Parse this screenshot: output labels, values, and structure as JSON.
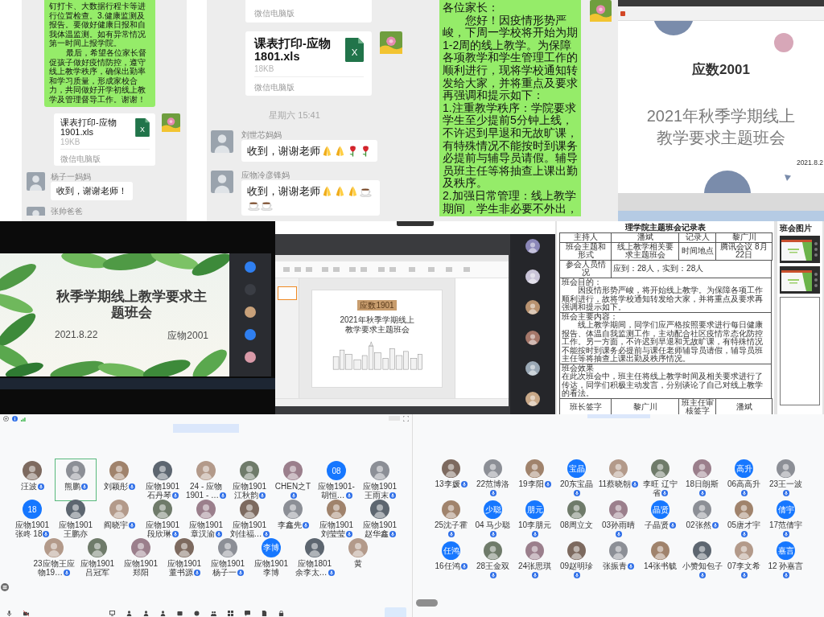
{
  "chats": [
    {
      "messages": [
        {
          "kind": "text",
          "from_me": true,
          "avatar": false,
          "paragraphs": [
            {
              "text": "钉打卡、大数据行程卡等进行位置检查。3.健康监测及报告。要做好健康日报和自我体温监测。如有异常情况第一时间上报学院。",
              "indent": false
            },
            {
              "text": "最后，希望各位家长督促孩子做好疫情防控，遵守线上教学秩序，确保出勤率和学习质量，形成家校合力，共同做好开学初线上教学及管理督导工作。谢谢！",
              "indent": true
            }
          ]
        },
        {
          "kind": "file",
          "from_me": true,
          "avatar": true,
          "name": "课表打印-应物1901.xls",
          "icon_text": "X",
          "size": "19KB",
          "source": "微信电脑版"
        },
        {
          "kind": "text",
          "from_me": false,
          "avatar": true,
          "sender": "杨子一妈妈",
          "paragraphs": [
            {
              "text": "收到，谢谢老师！",
              "indent": false
            }
          ]
        },
        {
          "kind": "sender_only",
          "from_me": false,
          "avatar": true,
          "sender": "张帅爸爸"
        }
      ]
    },
    {
      "messages": [
        {
          "kind": "file_tail",
          "from_me": true,
          "avatar": false,
          "source": "微信电脑版"
        },
        {
          "kind": "file",
          "from_me": true,
          "avatar": true,
          "name": "课表打印-应物1801.xls",
          "icon_text": "X",
          "size": "18KB",
          "source": "微信电脑版"
        },
        {
          "kind": "time",
          "text": "星期六 15:41"
        },
        {
          "kind": "text",
          "from_me": false,
          "avatar": true,
          "sender": "刘世芯妈妈",
          "paragraphs": [
            {
              "text": "收到，谢谢老师",
              "indent": false
            }
          ],
          "emojis": [
            {
              "kind": "hands"
            },
            {
              "kind": "hands"
            },
            {
              "kind": "rose"
            },
            {
              "kind": "rose"
            }
          ]
        },
        {
          "kind": "text",
          "from_me": false,
          "avatar": true,
          "sender": "应物冷彦锋妈",
          "paragraphs": [
            {
              "text": "收到，谢谢老师",
              "indent": false
            }
          ],
          "emojis": [
            {
              "kind": "hands"
            },
            {
              "kind": "hands"
            },
            {
              "kind": "hands"
            },
            {
              "kind": "coffee"
            },
            {
              "kind": "coffee"
            },
            {
              "kind": "coffee"
            }
          ]
        }
      ]
    },
    {
      "messages": [
        {
          "kind": "text",
          "from_me": true,
          "avatar": true,
          "paragraphs": [
            {
              "text": "各位家长：",
              "indent": false
            },
            {
              "text": "您好！因疫情形势严峻，下周一学校将开始为期1-2周的线上教学。为保障各项教学和学生管理工作的顺利进行，现将学校通知转发给大家，并将重点及要求再强调和提示如下：",
              "indent": true
            },
            {
              "text": "1.注重教学秩序：学院要求学生至少提前5分钟上线，不许迟到早退和无故旷课，有特殊情况不能按时到课务必提前与辅导员请假。辅导员班主任等将抽查上课出勤及秩序。",
              "indent": false
            },
            {
              "text": "2.加强日常管理：线上教学期间，学生非必要不外出，",
              "indent": false
            }
          ]
        }
      ]
    }
  ],
  "presentation": {
    "title": "应数2001",
    "subtitle": "2021年秋季学期线上教学要求主题班会",
    "date": "2021.8.2"
  },
  "slide_photo": {
    "title": "秋季学期线上教学要求主题班会",
    "date": "2021.8.22",
    "class_name": "应物2001"
  },
  "screen_share": {
    "slide_tag": "应数1901",
    "slide_title": "2021年秋季学期线上教学要求主题班会"
  },
  "record_form": {
    "title": "理学院主题班会记录表",
    "header_rows": [
      [
        "主持人",
        "潘斌",
        "记录人",
        "黎广川"
      ],
      [
        "班会主题和形式",
        "线上教学相关要求主题班会",
        "时间地点",
        "腾讯会议 8月22日"
      ]
    ],
    "attendance": {
      "label": "参会人员情况",
      "value": "应到：28人，实到：28人"
    },
    "sections": [
      {
        "heading": "班会目的：",
        "body": "因疫情形势严峻，将开始线上教学。为保障各项工作顺利进行，故将学校通知转发给大家，并将重点及要求再强调和提示如下。",
        "indent": true
      },
      {
        "heading": "班会主要内容：",
        "body": "线上教学期间，同学们应严格按照要求进行每日健康报告、体温自我监测工作，主动配合社区疫情常态化防控工作。另一方面，不许迟到早退和无故旷课，有特殊情况不能按时到课务必提前与课任老师辅导员请假，辅导员班主任等将抽查上课出勤及秩序情况。",
        "indent": true
      },
      {
        "heading": "班会效果",
        "body": "在此次班会中，班主任将线上教学时间及相关要求进行了传达，同学们积极主动发言，分别谈论了自己对线上教学的看法。",
        "indent": false
      }
    ],
    "signatures": [
      "班长签字",
      "黎广川",
      "班主任审核签字",
      "潘斌"
    ]
  },
  "photo_page": {
    "title": "班会图片"
  },
  "meetings": [
    {
      "participants": [
        {
          "name": "汪波",
          "kind": "photo",
          "mic": true,
          "speaking": false
        },
        {
          "name": "熊鹏",
          "kind": "photo",
          "mic": true,
          "speaking": true
        },
        {
          "name": "刘颖彤",
          "kind": "photo",
          "mic": true,
          "speaking": false
        },
        {
          "name": "应物1901石丹琴",
          "kind": "photo",
          "mic": true,
          "speaking": false
        },
        {
          "name": "24 - 应物1901 - …",
          "kind": "photo",
          "mic": true,
          "speaking": false
        },
        {
          "name": "应物1901江秋韵",
          "kind": "photo",
          "mic": true,
          "speaking": false
        },
        {
          "name": "CHEN之T",
          "kind": "photo",
          "mic": true,
          "speaking": false
        },
        {
          "name": "应物1901-胡恒…",
          "kind": "text",
          "avatar_text": "08",
          "mic": true,
          "speaking": false
        },
        {
          "name": "应物1901王雨末",
          "kind": "photo",
          "mic": true,
          "speaking": false
        },
        {
          "name": "应物1901 张咚 18",
          "kind": "text",
          "avatar_text": "18",
          "mic": true,
          "speaking": false
        },
        {
          "name": "应物1901王鹏亦",
          "kind": "photo",
          "mic": false,
          "speaking": false
        },
        {
          "name": "阎晓宇",
          "kind": "photo",
          "mic": true,
          "speaking": false
        },
        {
          "name": "应物1901段欣琳",
          "kind": "photo",
          "mic": true,
          "speaking": false
        },
        {
          "name": "应物1901章汉渝",
          "kind": "photo",
          "mic": true,
          "speaking": false
        },
        {
          "name": "应物1901刘佳福…",
          "kind": "photo",
          "mic": true,
          "speaking": false
        },
        {
          "name": "李鑫先",
          "kind": "photo",
          "mic": true,
          "speaking": false
        },
        {
          "name": "应物1901刘莹莹",
          "kind": "photo",
          "mic": true,
          "speaking": false
        },
        {
          "name": "应物1901赵华鑫",
          "kind": "photo",
          "mic": true,
          "speaking": false
        },
        {
          "name": "23应物王应物19…",
          "kind": "photo",
          "mic": true,
          "speaking": false
        },
        {
          "name": "应物1901吕冠军",
          "kind": "photo",
          "mic": false,
          "speaking": false
        },
        {
          "name": "应物1901郑阳",
          "kind": "photo",
          "mic": false,
          "speaking": false
        },
        {
          "name": "应物1901董书源",
          "kind": "photo",
          "mic": true,
          "speaking": false
        },
        {
          "name": "应物1901杨子一",
          "kind": "photo",
          "mic": true,
          "speaking": false
        },
        {
          "name": "应物1901李博",
          "kind": "text",
          "avatar_text": "李博",
          "mic": false,
          "speaking": false
        },
        {
          "name": "应物1801余李太…",
          "kind": "photo",
          "mic": true,
          "speaking": false
        },
        {
          "name": "黄",
          "kind": "photo",
          "mic": false,
          "speaking": false
        }
      ]
    },
    {
      "participants": [
        {
          "name": "13李媛",
          "kind": "photo",
          "mic": true,
          "speaking": false
        },
        {
          "name": "22范博洛",
          "kind": "photo",
          "mic": true,
          "speaking": false
        },
        {
          "name": "19李阳",
          "kind": "photo",
          "mic": true,
          "speaking": false
        },
        {
          "name": "20东宝晶",
          "kind": "text",
          "avatar_text": "宝晶",
          "mic": true,
          "speaking": false
        },
        {
          "name": "11蔡晓朝",
          "kind": "photo",
          "mic": true,
          "speaking": false
        },
        {
          "name": "李旺 辽宁省",
          "kind": "photo",
          "mic": true,
          "speaking": false
        },
        {
          "name": "18日朗斯",
          "kind": "photo",
          "mic": true,
          "speaking": false
        },
        {
          "name": "06高高升",
          "kind": "text",
          "avatar_text": "高升",
          "mic": true,
          "speaking": false
        },
        {
          "name": "23王一波",
          "kind": "photo",
          "mic": true,
          "speaking": false
        },
        {
          "name": "25沈子霍",
          "kind": "photo",
          "mic": true,
          "speaking": false
        },
        {
          "name": "04 马少聪",
          "kind": "text",
          "avatar_text": "少聪",
          "mic": true,
          "speaking": false
        },
        {
          "name": "10李朋元",
          "kind": "text",
          "avatar_text": "朋元",
          "mic": true,
          "speaking": false
        },
        {
          "name": "08周立文",
          "kind": "photo",
          "mic": false,
          "speaking": false
        },
        {
          "name": "03孙雨晴",
          "kind": "photo",
          "mic": true,
          "speaking": false
        },
        {
          "name": "子晶贤",
          "kind": "text",
          "avatar_text": "晶贤",
          "mic": true,
          "speaking": false
        },
        {
          "name": "02张然",
          "kind": "photo",
          "mic": true,
          "speaking": false
        },
        {
          "name": "05唐才宇",
          "kind": "photo",
          "mic": true,
          "speaking": false
        },
        {
          "name": "17范倩宇",
          "kind": "text",
          "avatar_text": "倩宇",
          "mic": true,
          "speaking": false
        },
        {
          "name": "16任鸿",
          "kind": "text",
          "avatar_text": "任鸿",
          "mic": true,
          "speaking": false
        },
        {
          "name": "28王金双",
          "kind": "photo",
          "mic": true,
          "speaking": false
        },
        {
          "name": "24张思琪",
          "kind": "photo",
          "mic": true,
          "speaking": false
        },
        {
          "name": "09赵明珍",
          "kind": "photo",
          "mic": true,
          "speaking": false
        },
        {
          "name": "张振青",
          "kind": "photo",
          "mic": true,
          "speaking": false
        },
        {
          "name": "14张书毓",
          "kind": "photo",
          "mic": false,
          "speaking": false
        },
        {
          "name": "小赞知包子",
          "kind": "photo",
          "mic": true,
          "speaking": false
        },
        {
          "name": "07李文希",
          "kind": "photo",
          "mic": true,
          "speaking": false
        },
        {
          "name": "12 孙嘉言",
          "kind": "text",
          "avatar_text": "嘉言",
          "mic": true,
          "speaking": false
        }
      ]
    }
  ]
}
